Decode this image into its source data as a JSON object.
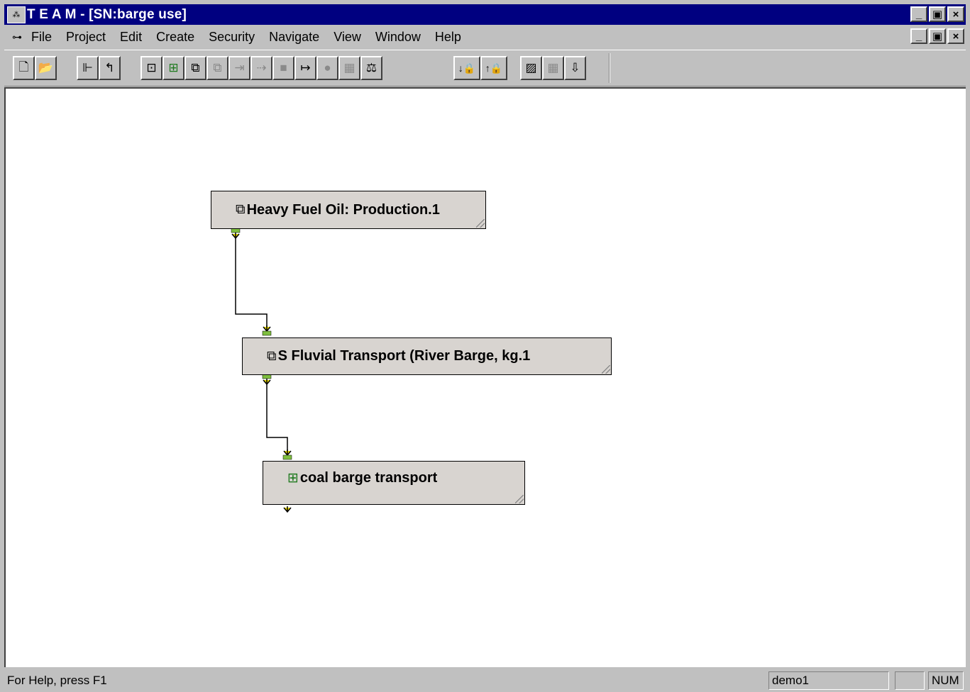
{
  "window": {
    "title": "T E A M - [SN:barge use]",
    "app_icon": "team-app-icon",
    "controls": [
      "_",
      "▣",
      "×"
    ]
  },
  "menubar": {
    "doc_icon": "document-network-icon",
    "items": [
      {
        "label": "File"
      },
      {
        "label": "Project"
      },
      {
        "label": "Edit"
      },
      {
        "label": "Create"
      },
      {
        "label": "Security"
      },
      {
        "label": "Navigate"
      },
      {
        "label": "View"
      },
      {
        "label": "Window"
      },
      {
        "label": "Help"
      }
    ]
  },
  "toolbar": {
    "buttons": [
      {
        "icon": "new-document-icon",
        "glyph": "🗋",
        "enabled": true
      },
      {
        "icon": "open-folder-icon",
        "glyph": "📂",
        "enabled": true
      },
      {
        "icon": "tree-view-icon",
        "glyph": "⊩",
        "enabled": true
      },
      {
        "icon": "up-level-icon",
        "glyph": "↰",
        "enabled": true
      },
      {
        "icon": "network-icon",
        "glyph": "⊡",
        "enabled": true
      },
      {
        "icon": "module-icon",
        "glyph": "⊞",
        "enabled": true
      },
      {
        "icon": "stacked-module-icon",
        "glyph": "⧉",
        "enabled": true
      },
      {
        "icon": "stacked-module-disabled-icon",
        "glyph": "⧉",
        "enabled": false
      },
      {
        "icon": "input-arrow-icon",
        "glyph": "⇥",
        "enabled": false
      },
      {
        "icon": "output-arrow-icon",
        "glyph": "⇢",
        "enabled": false
      },
      {
        "icon": "block-icon",
        "glyph": "■",
        "enabled": false
      },
      {
        "icon": "link-icon",
        "glyph": "↦",
        "enabled": true
      },
      {
        "icon": "circle-icon",
        "glyph": "●",
        "enabled": false
      },
      {
        "icon": "calculator-icon",
        "glyph": "▦",
        "enabled": false
      },
      {
        "icon": "balance-icon",
        "glyph": "⚖",
        "enabled": true
      },
      {
        "icon": "lock-down-icon",
        "glyph": "↓🔒",
        "enabled": true
      },
      {
        "icon": "lock-up-icon",
        "glyph": "↑🔒",
        "enabled": true
      },
      {
        "icon": "chart-icon",
        "glyph": "▨",
        "enabled": true
      },
      {
        "icon": "grid-icon",
        "glyph": "▦",
        "enabled": false
      },
      {
        "icon": "arrow-down-icon",
        "glyph": "⇩",
        "enabled": true
      }
    ]
  },
  "diagram": {
    "nodes": [
      {
        "label": "Heavy Fuel Oil: Production.1",
        "icon": "stacked-module-icon"
      },
      {
        "label": "S Fluvial Transport (River Barge, kg.1",
        "icon": "stacked-module-icon"
      },
      {
        "label": "coal barge transport",
        "icon": "module-icon"
      }
    ]
  },
  "statusbar": {
    "help_text": "For Help, press F1",
    "user": "demo1",
    "empty_pane": "",
    "num_lock": "NUM"
  }
}
